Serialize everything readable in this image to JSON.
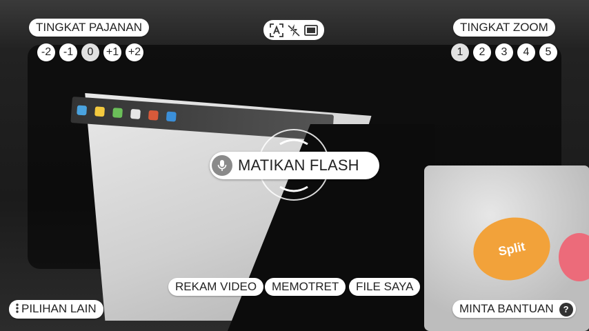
{
  "exposure": {
    "title": "TINGKAT PAJANAN",
    "levels": [
      "-2",
      "-1",
      "0",
      "+1",
      "+2"
    ],
    "selected": "0"
  },
  "zoom": {
    "title": "TINGKAT ZOOM",
    "levels": [
      "1",
      "2",
      "3",
      "4",
      "5"
    ],
    "selected": "1"
  },
  "top_icons": [
    "auto-text-icon",
    "flash-off-icon",
    "aspect-ratio-icon"
  ],
  "voice_command": {
    "label": "MATIKAN FLASH",
    "icon": "microphone-icon"
  },
  "scene": {
    "split_label": "Split"
  },
  "bottom_tabs": [
    {
      "label": "REKAM VIDEO"
    },
    {
      "label": "MEMOTRET"
    },
    {
      "label": "FILE SAYA"
    }
  ],
  "more_options": {
    "label": "PILIHAN LAIN",
    "icon": "more-vertical-icon"
  },
  "help": {
    "label": "MINTA BANTUAN",
    "icon": "help-icon",
    "icon_glyph": "?"
  },
  "colors": {
    "pill_bg": "#ffffff",
    "text": "#222222",
    "selected_level": "#e2e2e2"
  }
}
